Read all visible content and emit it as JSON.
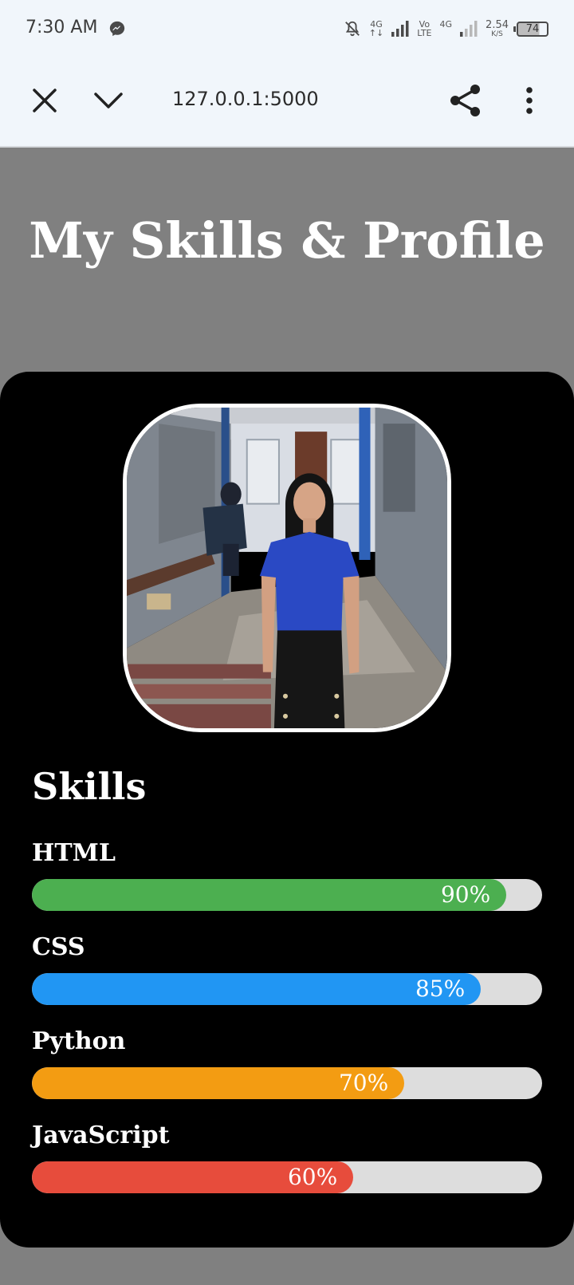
{
  "status_bar": {
    "time": "7:30 AM",
    "net1_top": "4G",
    "net1_bottom": "↑↓",
    "volte_top": "Vo",
    "volte_bottom": "LTE",
    "net2_top": "4G",
    "speed_value": "2.54",
    "speed_unit": "K/S",
    "battery": "74"
  },
  "browser": {
    "url": "127.0.0.1:5000"
  },
  "page": {
    "title": "My Skills & Profile",
    "skills_heading": "Skills"
  },
  "skills": [
    {
      "name": "HTML",
      "percent_label": "90%",
      "level": 0.93,
      "color": "#4caf50"
    },
    {
      "name": "CSS",
      "percent_label": "85%",
      "level": 0.88,
      "color": "#2196f3"
    },
    {
      "name": "Python",
      "percent_label": "70%",
      "level": 0.73,
      "color": "#f39c12"
    },
    {
      "name": "JavaScript",
      "percent_label": "60%",
      "level": 0.63,
      "color": "#e74c3c"
    }
  ],
  "icons": {
    "close": "close-icon",
    "chevron": "chevron-down-icon",
    "share": "share-icon",
    "more": "more-vertical-icon",
    "messenger": "messenger-icon",
    "mute": "bell-off-icon"
  }
}
